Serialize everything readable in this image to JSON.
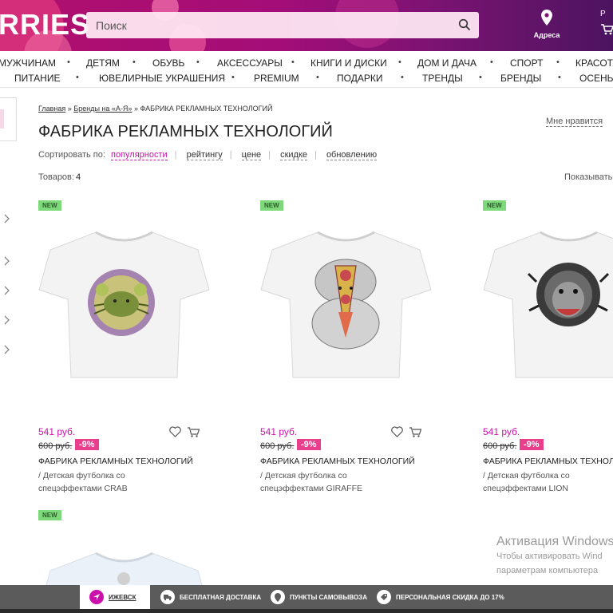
{
  "header": {
    "logo_text": "RRIES",
    "search_placeholder": "Поиск",
    "address_label": "Адреса",
    "cart_label": "Р",
    "accent": "#cb11ab"
  },
  "nav": {
    "row1": [
      "МУЖЧИНАМ",
      "ДЕТЯМ",
      "ОБУВЬ",
      "АКСЕССУАРЫ",
      "КНИГИ И ДИСКИ",
      "ДОМ И ДАЧА",
      "СПОРТ",
      "КРАСОТА"
    ],
    "row2": [
      "ПИТАНИЕ",
      "ЮВЕЛИРНЫЕ УКРАШЕНИЯ",
      "PREMIUM",
      "ПОДАРКИ",
      "ТРЕНДЫ",
      "БРЕНДЫ",
      "ОСЕНЬ"
    ]
  },
  "breadcrumbs": [
    "Главная",
    "Бренды на «А-Я»",
    "ФАБРИКА РЕКЛАМНЫХ ТЕХНОЛОГИЙ"
  ],
  "breadcrumb_sep": "»",
  "page_title": "ФАБРИКА РЕКЛАМНЫХ ТЕХНОЛОГИЙ",
  "like_label": "Мне нравится",
  "sort": {
    "label": "Сортировать по:",
    "options": [
      "популярности",
      "рейтингу",
      "цене",
      "скидке",
      "обновлению"
    ],
    "active": "популярности"
  },
  "count": {
    "label": "Товаров:",
    "value": "4"
  },
  "show_label": "Показывать",
  "products": [
    {
      "badge": "NEW",
      "price": "541 руб.",
      "old_price": "600 руб.",
      "discount": "-9%",
      "brand": "ФАБРИКА РЕКЛАМНЫХ ТЕХНОЛОГИЙ",
      "desc": "/ Детская футболка со спецэффектами CRAB",
      "print": "crab-print-icon"
    },
    {
      "badge": "NEW",
      "price": "541 руб.",
      "old_price": "600 руб.",
      "discount": "-9%",
      "brand": "ФАБРИКА РЕКЛАМНЫХ ТЕХНОЛОГИЙ",
      "desc": "/ Детская футболка со спецэффектами GIRAFFE",
      "print": "giraffe-print-icon"
    },
    {
      "badge": "NEW",
      "price": "541 руб.",
      "old_price": "600 руб.",
      "discount": "-9%",
      "brand": "ФАБРИКА РЕКЛАМНЫХ ТЕХНОЛОГИЙ",
      "desc": "/ Детская футболка со спецэффектами LION",
      "print": "lion-print-icon"
    },
    {
      "badge": "NEW"
    }
  ],
  "activation": {
    "title": "Активация Windows",
    "line1": "Чтобы активировать Wind",
    "line2": "параметрам компьютера"
  },
  "footer": {
    "city": "ИЖЕВСК",
    "items": [
      "БЕСПЛАТНАЯ ДОСТАВКА",
      "ПУНКТЫ САМОВЫВОЗА",
      "ПЕРСОНАЛЬНАЯ СКИДКА ДО 17%"
    ]
  }
}
